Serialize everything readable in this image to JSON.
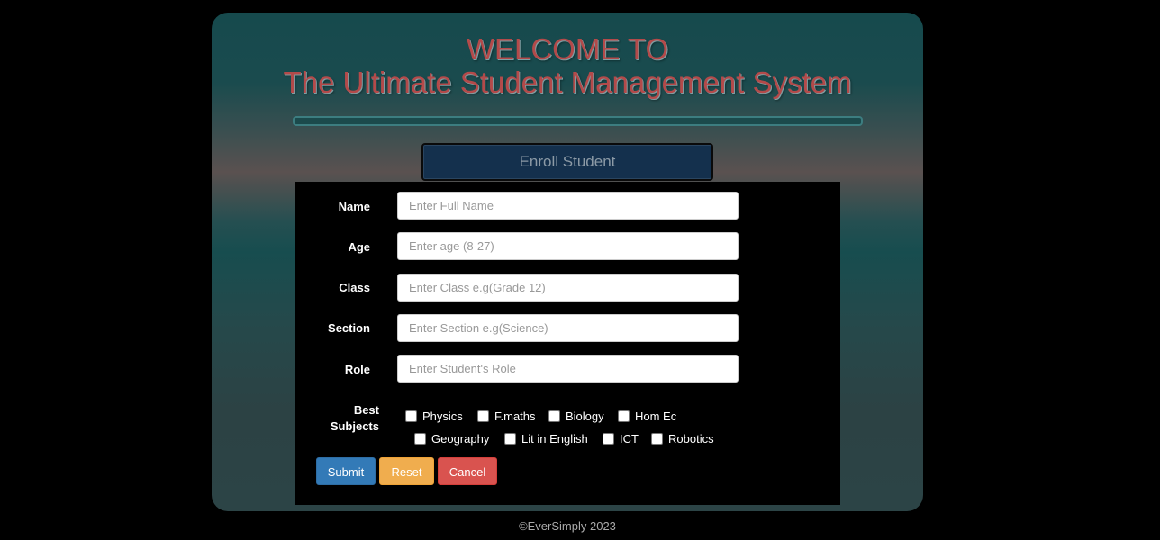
{
  "header": {
    "line1": "WELCOME TO",
    "line2": "The Ultimate Student Management System"
  },
  "enroll_tab": {
    "label": "Enroll Student"
  },
  "form": {
    "fields": [
      {
        "label": "Name",
        "placeholder": "Enter Full Name",
        "value": ""
      },
      {
        "label": "Age",
        "placeholder": "Enter age (8-27)",
        "value": ""
      },
      {
        "label": "Class",
        "placeholder": "Enter Class e.g(Grade 12)",
        "value": ""
      },
      {
        "label": "Section",
        "placeholder": "Enter Section e.g(Science)",
        "value": ""
      },
      {
        "label": "Role",
        "placeholder": "Enter Student's Role",
        "value": ""
      }
    ],
    "subjects": {
      "label_line1": "Best",
      "label_line2": "Subjects",
      "items": [
        {
          "label": "Physics",
          "checked": false
        },
        {
          "label": "F.maths",
          "checked": false
        },
        {
          "label": "Biology",
          "checked": false
        },
        {
          "label": "Hom Ec",
          "checked": false
        },
        {
          "label": "Geography",
          "checked": false
        },
        {
          "label": "Lit in English",
          "checked": false
        },
        {
          "label": "ICT",
          "checked": false
        },
        {
          "label": "Robotics",
          "checked": false
        }
      ]
    },
    "buttons": {
      "submit": "Submit",
      "reset": "Reset",
      "cancel": "Cancel"
    }
  },
  "footer": {
    "text": "©EverSimply 2023"
  },
  "colors": {
    "title": "#b34a4a",
    "enroll_bg": "#14304d",
    "submit": "#337ab7",
    "reset": "#f0ad4e",
    "cancel": "#d9534f"
  }
}
